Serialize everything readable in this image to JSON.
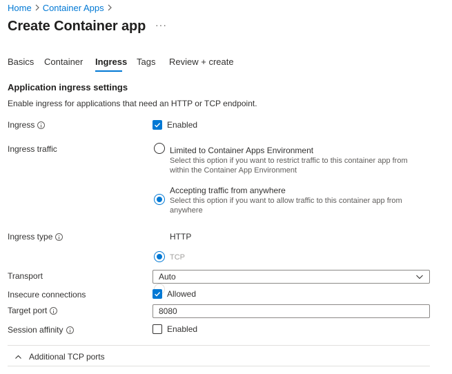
{
  "breadcrumb": {
    "home": "Home",
    "container_apps": "Container Apps"
  },
  "page": {
    "title": "Create Container app",
    "more": "···"
  },
  "tabs": [
    {
      "label": "Basics"
    },
    {
      "label": "Container"
    },
    {
      "label": "Ingress",
      "active": true
    },
    {
      "label": "Tags"
    },
    {
      "label": "Review + create"
    }
  ],
  "section": {
    "title": "Application ingress settings",
    "description": "Enable ingress for applications that need an HTTP or TCP endpoint."
  },
  "ingress": {
    "label": "Ingress",
    "checkbox_label": "Enabled",
    "checked": true
  },
  "ingress_traffic": {
    "label": "Ingress traffic",
    "options": [
      {
        "label": "Limited to Container Apps Environment",
        "description": "Select this option if you want to restrict traffic to this container app from within the Container App Environment",
        "selected": false
      },
      {
        "label": "Accepting traffic from anywhere",
        "description": "Select this option if you want to allow traffic to this container app from anywhere",
        "selected": true
      }
    ]
  },
  "ingress_type": {
    "label": "Ingress type",
    "options": [
      {
        "label": "HTTP",
        "selected": true,
        "disabled": false
      },
      {
        "label": "TCP",
        "selected": false,
        "disabled": true
      }
    ]
  },
  "transport": {
    "label": "Transport",
    "value": "Auto"
  },
  "insecure": {
    "label": "Insecure connections",
    "checkbox_label": "Allowed",
    "checked": true
  },
  "target_port": {
    "label": "Target port",
    "value": "8080"
  },
  "session_affinity": {
    "label": "Session affinity",
    "checkbox_label": "Enabled",
    "checked": false
  },
  "additional_tcp": {
    "label": "Additional TCP ports"
  },
  "colors": {
    "accent": "#0078d4",
    "text": "#323130",
    "muted": "#605e5c",
    "disabled": "#a19f9d"
  }
}
